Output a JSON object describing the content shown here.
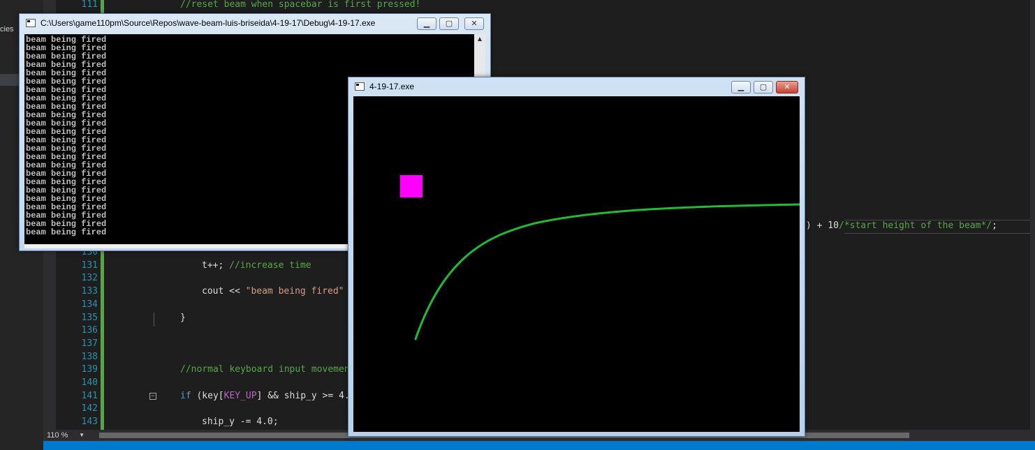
{
  "sidebar": {
    "fragment": "cies"
  },
  "editor": {
    "zoom": "110 %",
    "line_numbers": {
      "l111": "111",
      "l130": "130",
      "l131": "131",
      "l132": "132",
      "l133": "133",
      "l134": "134",
      "l135": "135",
      "l136": "136",
      "l137": "137",
      "l138": "138",
      "l139": "139",
      "l140": "140",
      "l141": "141",
      "l142": "142",
      "l143": "143"
    },
    "code": {
      "l111_comment": "//reset beam when spacebar is first pressed!",
      "l129_tail_a": ") + 10",
      "l129_tail_b": "/*start height of the beam*/",
      "l129_tail_c": ";",
      "l131_code": "t++; ",
      "l131_comment": "//increase time",
      "l133_code": "cout << ",
      "l133_str": "\"beam being fired\"",
      "l135_code": "}",
      "l139_comment": "//normal keyboard input movemen",
      "l141_kw": "if",
      "l141_a": " (key[",
      "l141_macro": "KEY_UP",
      "l141_b": "] && ship_y >= 4.",
      "l143_code": "ship_y -= 4.0;"
    }
  },
  "console_window": {
    "title": "C:\\Users\\game110pm\\Source\\Repos\\wave-beam-luis-briseida\\4-19-17\\Debug\\4-19-17.exe",
    "output_lines": [
      "beam being fired",
      "beam being fired",
      "beam being fired",
      "beam being fired",
      "beam being fired",
      "beam being fired",
      "beam being fired",
      "beam being fired",
      "beam being fired",
      "beam being fired",
      "beam being fired",
      "beam being fired",
      "beam being fired",
      "beam being fired",
      "beam being fired",
      "beam being fired",
      "beam being fired",
      "beam being fired",
      "beam being fired",
      "beam being fired",
      "beam being fired",
      "beam being fired",
      "beam being fired",
      "beam being fired"
    ]
  },
  "game_window": {
    "title": "4-19-17.exe",
    "ship_color": "#ff00ff",
    "beam_color": "#22bb33"
  },
  "window_buttons": {
    "minimize": "▁",
    "maximize": "▢",
    "close": "✕"
  }
}
